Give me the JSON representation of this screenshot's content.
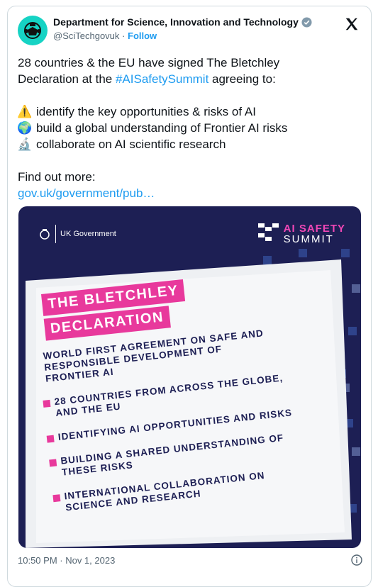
{
  "account": {
    "name": "Department for Science, Innovation and Technology",
    "handle": "@SciTechgovuk",
    "separator": "·",
    "follow_label": "Follow"
  },
  "post": {
    "intro_line1": "28 countries & the EU have signed The Bletchley",
    "intro_line2_pre": "Declaration at the ",
    "hashtag": "#AISafetySummit",
    "intro_line2_post": " agreeing to:",
    "bullets": [
      {
        "icon": "warning-icon",
        "glyph": "⚠️",
        "text": "identify the key opportunities & risks of AI"
      },
      {
        "icon": "globe-icon",
        "glyph": "🌍",
        "text": "build a global understanding of Frontier AI risks"
      },
      {
        "icon": "microscope-icon",
        "glyph": "🔬",
        "text": "collaborate on AI scientific research"
      }
    ],
    "find_out": "Find out more:",
    "link": "gov.uk/government/pub…"
  },
  "media": {
    "uk_gov": "UK Government",
    "ai_line1": "AI SAFETY",
    "ai_line2": "SUMMIT",
    "title_line1": "THE BLETCHLEY",
    "title_line2": "DECLARATION",
    "subtitle": "WORLD FIRST AGREEMENT ON SAFE AND RESPONSIBLE DEVELOPMENT OF FRONTIER AI",
    "items": [
      "28 COUNTRIES FROM ACROSS THE GLOBE, AND THE EU",
      "IDENTIFYING AI OPPORTUNITIES AND RISKS",
      "BUILDING A SHARED UNDERSTANDING OF THESE RISKS",
      "INTERNATIONAL COLLABORATION ON SCIENCE AND RESEARCH"
    ]
  },
  "footer": {
    "timestamp": "10:50 PM · Nov 1, 2023"
  },
  "colors": {
    "link": "#1d9bf0",
    "navy": "#1d1f54",
    "pink": "#e8399c",
    "avatar_bg": "#16d3c4"
  }
}
